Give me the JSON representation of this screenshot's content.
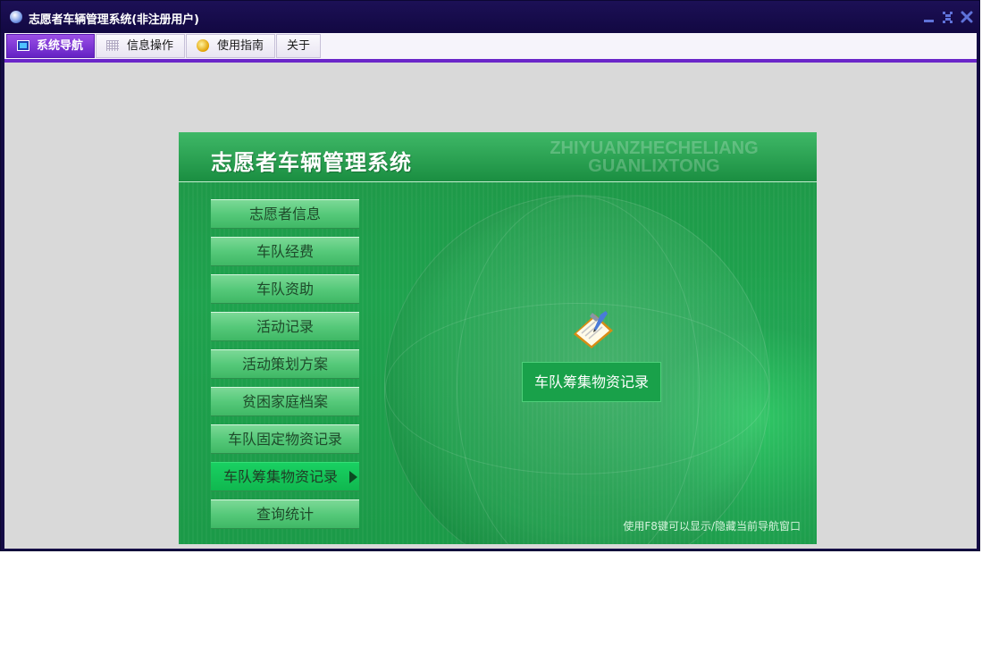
{
  "window": {
    "title": "志愿者车辆管理系统(非注册用户)",
    "controls": {
      "minimize_icon": "minimize-icon",
      "restore_icon": "restore-icon",
      "close_icon": "close-icon"
    }
  },
  "menubar": {
    "items": [
      {
        "label": "系统导航",
        "icon": "monitor-icon",
        "active": true
      },
      {
        "label": "信息操作",
        "icon": "grid-icon",
        "active": false
      },
      {
        "label": "使用指南",
        "icon": "guide-icon",
        "active": false
      },
      {
        "label": "关于",
        "icon": "",
        "active": false
      }
    ],
    "accent_color": "#6a26c9"
  },
  "panel": {
    "title": "志愿者车辆管理系统",
    "watermark_line1": "ZHIYUANZHECHELIANG",
    "watermark_line2": "GUANLIXTONG",
    "nav_items": [
      "志愿者信息",
      "车队经费",
      "车队资助",
      "活动记录",
      "活动策划方案",
      "贫困家庭档案",
      "车队固定物资记录",
      "车队筹集物资记录",
      "查询统计"
    ],
    "active_index": 7,
    "selected_label": "车队筹集物资记录",
    "selected_icon": "clipboard-icon",
    "hint": "使用F8键可以显示/隐藏当前导航窗口",
    "colors": {
      "panel_green": "#1ea24d",
      "button_green": "#56c97a",
      "active_green": "#19d062"
    }
  }
}
